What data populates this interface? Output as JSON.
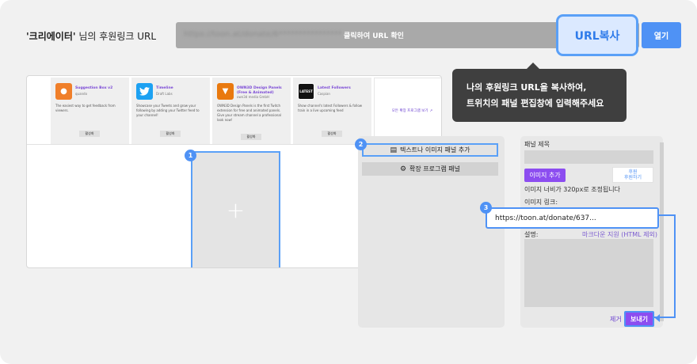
{
  "header": {
    "creator_name": "'크리에이터'",
    "title_suffix": " 님의 후원링크 URL",
    "url_value": "https://toon.at/donate/6****************",
    "url_hint": "클릭하여 URL 확인",
    "copy_label": "URL복사",
    "open_label": "열기"
  },
  "tooltip": {
    "line1": "나의 후원링크 URL을 복사하여,",
    "line2": "트위치의 패널 편집창에 입력해주세요"
  },
  "extensions": [
    {
      "name": "Suggestion Box v2",
      "author": "quando",
      "desc": "The easiest way to get feedback from viewers.",
      "action": "활성화",
      "icon_color": "#f07f2a",
      "icon": "lightbulb-icon"
    },
    {
      "name": "Timeline",
      "author": "Draft Labs",
      "desc": "Showcase your Tweets and grow your following by adding your Twitter feed to your channel!",
      "action": "활성화",
      "icon_color": "#1da1f2",
      "icon": "twitter-bird-icon"
    },
    {
      "name": "OWN3D Design Panels (Free & Animated)",
      "author": "own3d media GmbH",
      "desc": "OWN3D Design Panels is the first Twitch extension for free and animated panels. Give your stream channel a professional look now!",
      "action": "활성화",
      "icon_color": "#e9790e",
      "icon": "own3d-logo-icon"
    },
    {
      "name": "Latest Followers",
      "author": "Caspian",
      "desc": "Show channel's latest Followers & follow train in a live upcoming feed",
      "action": "활성화",
      "icon_color": "#111111",
      "icon": "latest-icon"
    }
  ],
  "more_extensions": "모든 확장 프로그램 보기",
  "callouts": [
    "1",
    "2",
    "3"
  ],
  "options": {
    "text_image_panel": "텍스트나 이미지 패널 추가",
    "extension_panel": "확장 프로그램 패널"
  },
  "editor": {
    "panel_title_label": "패널 제목",
    "add_image_label": "이미지 추가",
    "thumb_text_line1": "후원",
    "thumb_text_line2": "후원하기",
    "resize_note": "이미지 너비가 320px로 조정됩니다",
    "image_link_label": "이미지 링크:",
    "image_link_value": "https://toon.at/donate/637...",
    "description_label": "설명:",
    "description_hint": "마크다운 지원 (HTML 제외)",
    "remove_label": "제거",
    "send_label": "보내기"
  },
  "colors": {
    "accent_blue": "#4f92f5",
    "twitch_purple": "#8c4df0"
  }
}
